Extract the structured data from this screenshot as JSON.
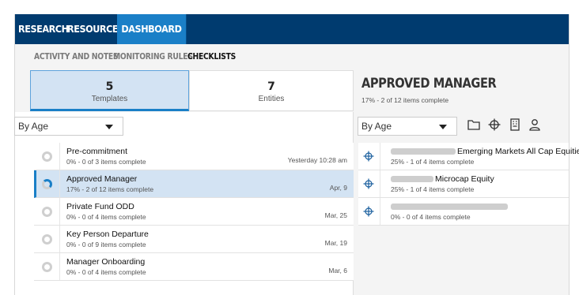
{
  "nav": {
    "items": [
      {
        "label": "RESEARCH"
      },
      {
        "label": "RESOURCES"
      },
      {
        "label": "DASHBOARD",
        "active": true
      }
    ]
  },
  "subnav": {
    "items": [
      {
        "label": "ACTIVITY AND NOTES"
      },
      {
        "label": "MONITORING RULES"
      },
      {
        "label": "CHECKLISTS",
        "active": true
      }
    ]
  },
  "counters": {
    "templates": {
      "count": "5",
      "label": "Templates"
    },
    "entities": {
      "count": "7",
      "label": "Entities"
    }
  },
  "left": {
    "sort": {
      "value": "By Age"
    },
    "items": [
      {
        "title": "Pre-commitment",
        "sub": "0% - 0 of 3 items complete",
        "date": "Yesterday 10:28 am"
      },
      {
        "title": "Approved Manager",
        "sub": "17% - 2 of 12 items complete",
        "date": "Apr, 9"
      },
      {
        "title": "Private Fund ODD",
        "sub": "0% - 0 of 4 items complete",
        "date": "Mar, 25"
      },
      {
        "title": "Key Person Departure",
        "sub": "0% - 0 of 9 items complete",
        "date": "Mar, 19"
      },
      {
        "title": "Manager Onboarding",
        "sub": "0% - 0 of 4 items complete",
        "date": "Mar, 6"
      }
    ]
  },
  "right": {
    "title": "APPROVED MANAGER",
    "subtitle": "17% - 2 of 12 items complete",
    "sort": {
      "value": "By Age"
    },
    "tools": [
      "folder-icon",
      "crosshair-icon",
      "building-icon",
      "person-icon"
    ],
    "items": [
      {
        "title": "Emerging Markets All Cap Equities",
        "sub": "25% - 1 of 4 items complete"
      },
      {
        "title": "Microcap Equity",
        "sub": "25% - 1 of 4 items complete"
      },
      {
        "title": "",
        "sub": "0% - 0 of 4 items complete"
      }
    ]
  },
  "colors": {
    "nav_bg": "#003b6f",
    "accent": "#1a7fc7",
    "selected_bg": "#d3e3f3"
  }
}
